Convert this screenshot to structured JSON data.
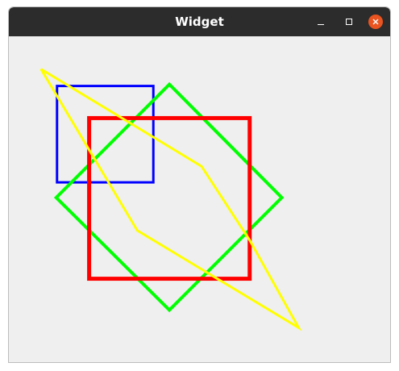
{
  "window": {
    "title": "Widget",
    "controls": {
      "minimize": "minimize-icon",
      "maximize": "maximize-icon",
      "close": "close-icon"
    }
  },
  "colors": {
    "titlebar": "#2c2c2c",
    "background": "#efefef",
    "close": "#e95420",
    "blue_square": "#0000ff",
    "green_diamond": "#00ff00",
    "red_square": "#ff0000",
    "yellow_polygon": "#ffff00"
  }
}
